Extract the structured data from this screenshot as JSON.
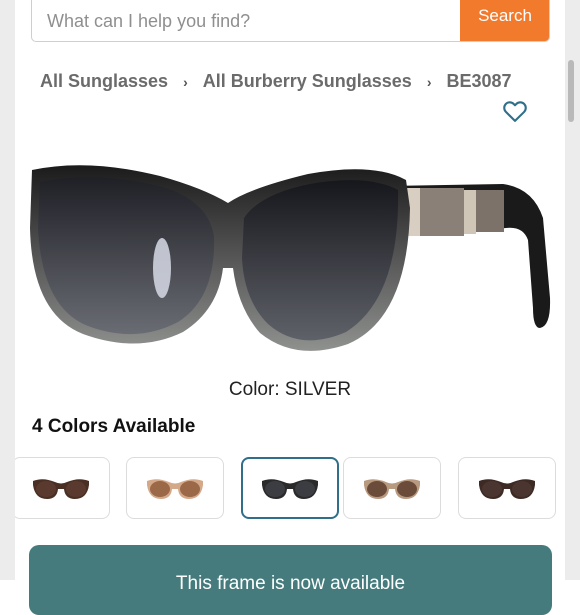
{
  "search": {
    "placeholder": "What can I help you find?",
    "button_label": "Search"
  },
  "breadcrumb": [
    {
      "label": "All Sunglasses"
    },
    {
      "label": "All Burberry Sunglasses"
    },
    {
      "label": "BE3087"
    }
  ],
  "breadcrumb_separator": "›",
  "icons": {
    "favorite": "heart-outline-icon",
    "breadcrumb_separator": "chevron-right-icon"
  },
  "product": {
    "color_text": "Color: SILVER",
    "colors_available": "4 Colors Available",
    "swatches": [
      {
        "frame_color": "#4a2f24",
        "lens_color": "#5a3a2e",
        "selected": false
      },
      {
        "frame_color": "#d4a98a",
        "lens_color": "#9b6848",
        "selected": false
      },
      {
        "frame_color": "#2a2a2a",
        "lens_color": "#3b3d42",
        "selected": true
      },
      {
        "frame_color": "#b89a80",
        "lens_color": "#6b4c3a",
        "selected": false
      },
      {
        "frame_color": "#3d2a24",
        "lens_color": "#4b3530",
        "selected": false
      }
    ]
  },
  "availability_text": "This frame is now available",
  "colors": {
    "accent": "#f27a2c",
    "selected_border": "#2f6f8a",
    "availability_bg": "#457b7c"
  }
}
